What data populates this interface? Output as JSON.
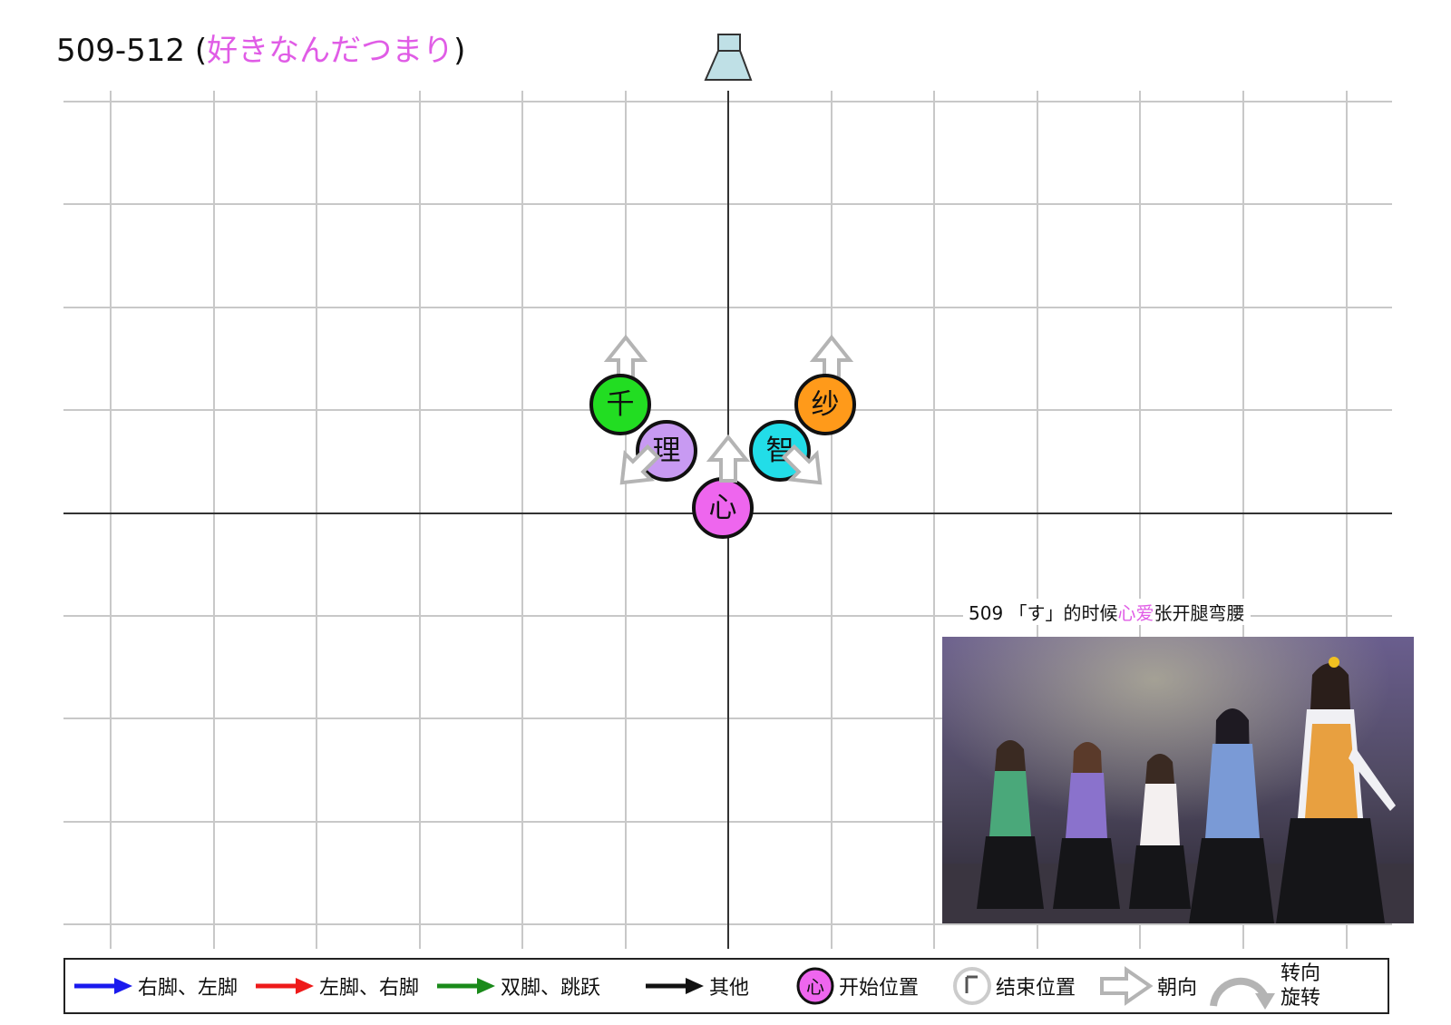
{
  "title": {
    "prefix": "509-512 (",
    "song": "好きなんだつまり",
    "suffix": ")"
  },
  "members": [
    {
      "label": "千",
      "color": "#22dd22"
    },
    {
      "label": "理",
      "color": "#c89af2"
    },
    {
      "label": "心",
      "color": "#ee66ee"
    },
    {
      "label": "智",
      "color": "#22dde8"
    },
    {
      "label": "纱",
      "color": "#ff9a1a"
    }
  ],
  "caption": {
    "prefix": "509 「す」的时候",
    "name": "心爱",
    "suffix": "张开腿弯腰"
  },
  "legend": {
    "blue_arrow": "右脚、左脚",
    "red_arrow": "左脚、右脚",
    "green_arrow": "双脚、跳跃",
    "black_arrow": "其他",
    "start_label": "开始位置",
    "start_icon_char": "心",
    "end_label": "结束位置",
    "facing_label": "朝向",
    "turn_label_1": "转向",
    "turn_label_2": "旋转"
  },
  "colors": {
    "accent_pink": "#e05ce6",
    "grid": "#c8c8c8",
    "blue": "#1a1aee",
    "red": "#ee1a1a",
    "green": "#1a8a1a",
    "speaker": "#bfe0e6"
  }
}
